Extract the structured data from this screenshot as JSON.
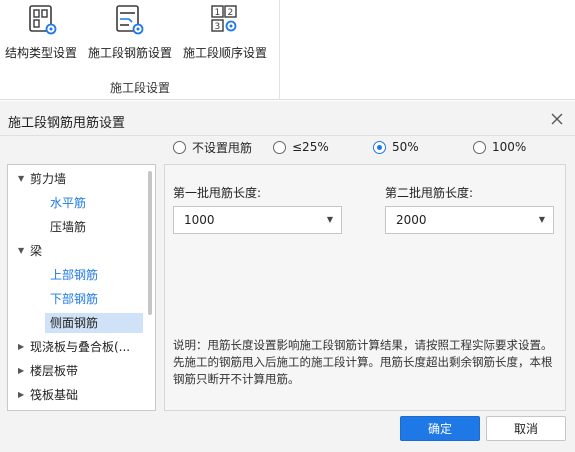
{
  "ribbon": {
    "buttons": [
      {
        "label": "结构类型设置",
        "icon": "structure-grid-gear-icon"
      },
      {
        "label": "施工段钢筋设置",
        "icon": "rebar-gear-icon"
      },
      {
        "label": "施工段顺序设置",
        "icon": "sequence-numbers-gear-icon"
      }
    ],
    "group_title": "施工段设置"
  },
  "dialog": {
    "title": "施工段钢筋甩筋设置",
    "radio_options": [
      {
        "label": "不设置甩筋",
        "selected": false
      },
      {
        "label": "≤25%",
        "selected": false
      },
      {
        "label": "50%",
        "selected": true
      },
      {
        "label": "100%",
        "selected": false
      }
    ],
    "tree": {
      "nodes": [
        {
          "label": "剪力墙",
          "expanded": true,
          "children": [
            "水平筋",
            "压墙筋"
          ]
        },
        {
          "label": "梁",
          "expanded": true,
          "children": [
            "上部钢筋",
            "下部钢筋",
            "侧面钢筋"
          ]
        },
        {
          "label": "现浇板与叠合板(...",
          "expanded": false
        },
        {
          "label": "楼层板带",
          "expanded": false
        },
        {
          "label": "筏板基础",
          "expanded": false
        }
      ],
      "selected": "侧面钢筋"
    },
    "first_batch": {
      "label": "第一批甩筋长度:",
      "value": "1000"
    },
    "second_batch": {
      "label": "第二批甩筋长度:",
      "value": "2000"
    },
    "note": "说明：甩筋长度设置影响施工段钢筋计算结果，请按照工程实际要求设置。先施工的钢筋甩入后施工的施工段计算。甩筋长度超出剩余钢筋长度，本根钢筋只断开不计算甩筋。",
    "ok_label": "确定",
    "cancel_label": "取消"
  },
  "colors": {
    "accent": "#1e78e6",
    "tree_child_text": "#1e78e6",
    "selection_bg": "#cfe2f8"
  }
}
